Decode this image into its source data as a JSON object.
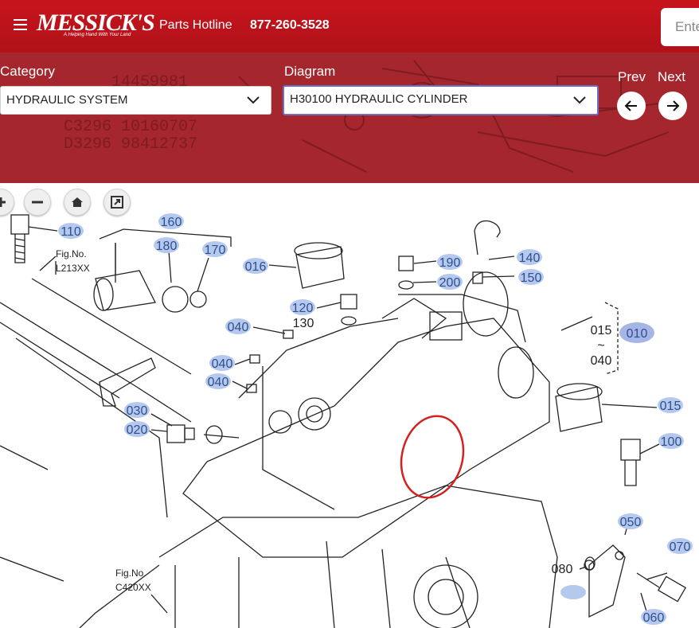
{
  "header": {
    "hotline_label": "Parts Hotline",
    "hotline_number": "877-260-3528",
    "search_placeholder": "Ente",
    "logo_text": "MESSICK'S",
    "logo_tagline": "A Helping Hand With Your Land",
    "brand_color": "#c0141c"
  },
  "selectors": {
    "category_label": "Category",
    "category_value": "HYDRAULIC SYSTEM",
    "diagram_label": "Diagram",
    "diagram_value": "H30100 HYDRAULIC CYLINDER",
    "prev_label": "Prev",
    "next_label": "Next"
  },
  "banner_bg_text": [
    "14459981",
    "C3296 10160707",
    "D3296 98412737"
  ],
  "toolbar": {
    "icons": [
      "zoom-in-icon",
      "zoom-out-icon",
      "home-icon",
      "fullscreen-icon"
    ]
  },
  "diagram": {
    "callouts": [
      "110",
      "160",
      "180",
      "170",
      "016",
      "190",
      "140",
      "200",
      "150",
      "120",
      "010",
      "040",
      "040",
      "040",
      "015",
      "030",
      "020",
      "100",
      "050",
      "070",
      "060"
    ],
    "plain_labels": [
      "130",
      "015",
      "~",
      "040",
      "080"
    ],
    "fig_refs": [
      "Fig.No.",
      "L213XX",
      "Fig.No.",
      "C420XX"
    ],
    "highlight_color": "#b5c9ee",
    "marker_color": "#d42020"
  }
}
